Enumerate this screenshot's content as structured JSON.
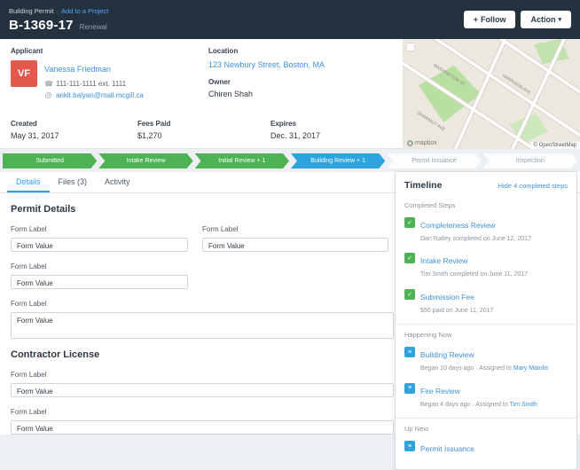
{
  "header": {
    "record_type": "Building Permit",
    "separator": "·",
    "add_to_project": "Add to a Project",
    "permit_id": "B-1369-17",
    "permit_type": "Renewal",
    "follow_icon": "+",
    "follow_label": "Follow",
    "action_label": "Action",
    "action_caret": "▾"
  },
  "applicant": {
    "label": "Applicant",
    "avatar_initials": "VF",
    "name": "Vanessa Friedman",
    "phone_icon": "☎",
    "phone": "111-111-1111 ext. 1111",
    "email_icon": "@",
    "email": "ankit.balyan@mail.mcgill.ca"
  },
  "location": {
    "label": "Location",
    "address": "123 Newbury Street, Boston, MA",
    "owner_label": "Owner",
    "owner_name": "Chiren Shah"
  },
  "meta": [
    {
      "label": "Created",
      "value": "May 31, 2017"
    },
    {
      "label": "Fees Paid",
      "value": "$1,270"
    },
    {
      "label": "Expires",
      "value": "Dec. 31, 2017"
    }
  ],
  "map": {
    "streets": [
      "WASHINGTON ST",
      "HARRISON AVE",
      "SHAWMUT AVE"
    ],
    "brand": "mapbox",
    "attribution": "© OpenStreetMap"
  },
  "stepper": {
    "steps": [
      {
        "label": "Submitted",
        "state": "complete"
      },
      {
        "label": "Intake Review",
        "state": "complete"
      },
      {
        "label": "Initial Review + 1",
        "state": "complete"
      },
      {
        "label": "Building Review + 1",
        "state": "active"
      },
      {
        "label": "Permit Issuance",
        "state": "pending"
      },
      {
        "label": "Inspection",
        "state": "pending"
      }
    ]
  },
  "tabs": [
    {
      "label": "Details"
    },
    {
      "label": "Files (3)"
    },
    {
      "label": "Activity"
    }
  ],
  "form": {
    "permit_details": {
      "title": "Permit Details",
      "fields": [
        {
          "label": "Form Label",
          "value": "Form Value"
        },
        {
          "label": "Form Label",
          "value": "Form Value"
        },
        {
          "label": "Form Label",
          "value": "Form Value"
        },
        {
          "label": "Form Label",
          "value": "Form Value"
        }
      ]
    },
    "contractor": {
      "title": "Contractor License",
      "fields": [
        {
          "label": "Form Label",
          "value": "Form Value"
        },
        {
          "label": "Form Label",
          "value": "Form Value"
        }
      ]
    }
  },
  "timeline": {
    "title": "Timeline",
    "toggle_link": "Hide 4 completed steps",
    "check_icon": "✓",
    "doc_icon": "≡",
    "completed_heading": "Completed Steps",
    "completed": [
      {
        "title": "Completeness Review",
        "subtitle": "Dan Ratley completed on June 12, 2017"
      },
      {
        "title": "Intake Review",
        "subtitle": "Tim Smith completed on June 11, 2017"
      },
      {
        "title": "Submission Fee",
        "subtitle": "$50 paid on June 11, 2017"
      }
    ],
    "happening_heading": "Happening Now",
    "happening": [
      {
        "title": "Building Review",
        "prefix": "Began 10 days ago · Assigned to ",
        "assignee": "Mary Matolis"
      },
      {
        "title": "Fire Review",
        "prefix": "Began 4 days ago · Assigned to ",
        "assignee": "Tim Smith"
      }
    ],
    "upnext_heading": "Up Next",
    "upnext": [
      {
        "title": "Permit Issuance"
      }
    ]
  },
  "colors": {
    "header_bg": "#24323f",
    "step_green": "#4cb253",
    "step_blue": "#2da4dd",
    "link_blue": "#3d92e0",
    "tab_accent": "#2f9ee8",
    "avatar_red": "#e4584e",
    "page_bg": "#edf0f2"
  }
}
